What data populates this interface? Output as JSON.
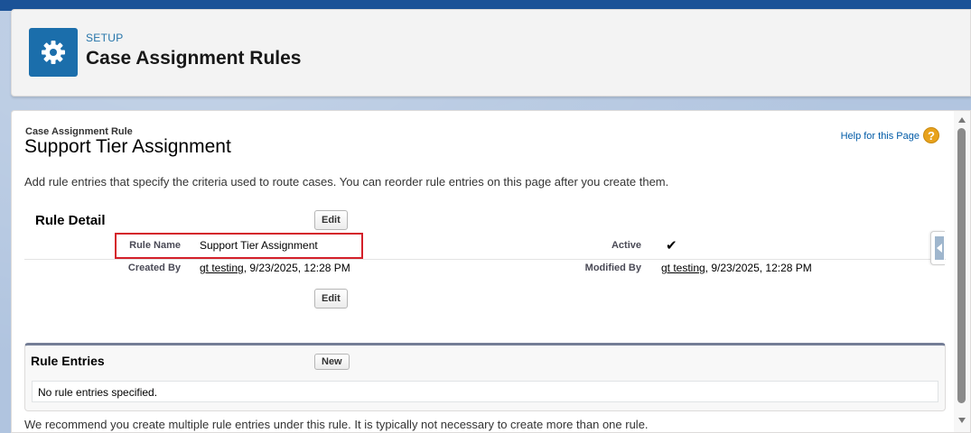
{
  "header": {
    "eyebrow": "SETUP",
    "title": "Case Assignment Rules",
    "icon": "gear-icon",
    "icon_bg": "#1b6eab"
  },
  "rule": {
    "eyebrow": "Case Assignment Rule",
    "title": "Support Tier Assignment",
    "help_link": "Help for this Page",
    "help_icon_glyph": "?",
    "description": "Add rule entries that specify the criteria used to route cases. You can reorder rule entries on this page after you create them."
  },
  "detail": {
    "section_title": "Rule Detail",
    "edit_label": "Edit",
    "rule_name_label": "Rule Name",
    "rule_name_value": "Support Tier Assignment",
    "active_label": "Active",
    "active_glyph": "✔",
    "created_by_label": "Created By",
    "created_by_user": "gt testing",
    "created_by_date": ", 9/23/2025, 12:28 PM",
    "modified_by_label": "Modified By",
    "modified_by_user": "gt testing",
    "modified_by_date": ", 9/23/2025, 12:28 PM"
  },
  "entries": {
    "section_title": "Rule Entries",
    "new_label": "New",
    "empty_text": "No rule entries specified."
  },
  "footer_note": "We recommend you create multiple rule entries under this rule. It is typically not necessary to create more than one rule.",
  "colors": {
    "highlight": "#d4202a",
    "link": "#015ba7"
  }
}
